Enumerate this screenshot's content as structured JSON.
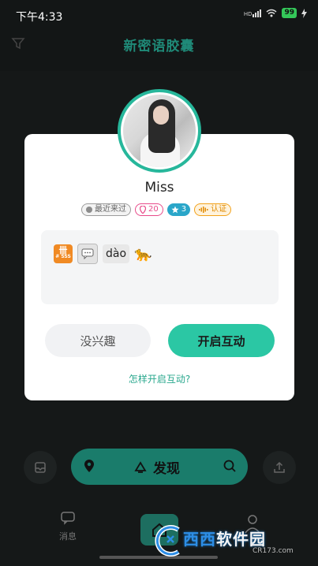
{
  "status_bar": {
    "time": "下午4:33",
    "signal": "HD",
    "battery": "99"
  },
  "header": {
    "title": "新密语胶囊"
  },
  "card": {
    "name": "Miss",
    "tags": {
      "recent": "最近来过",
      "likes": "20",
      "stars": "3",
      "verified": "认证"
    },
    "message": {
      "badge_text": "# SSS",
      "pinyin": "dào"
    },
    "no_interest_button": "没兴趣",
    "start_button": "开启互动",
    "help_link": "怎样开启互动?"
  },
  "bottom": {
    "discover_label": "发现",
    "nav_messages": "消息"
  },
  "watermark": {
    "brand_prefix": "西西",
    "brand_suffix": "软件园",
    "url": "CR173.com"
  },
  "colors": {
    "accent": "#2bc7a4",
    "header": "#1f8a78",
    "background": "#131616"
  }
}
